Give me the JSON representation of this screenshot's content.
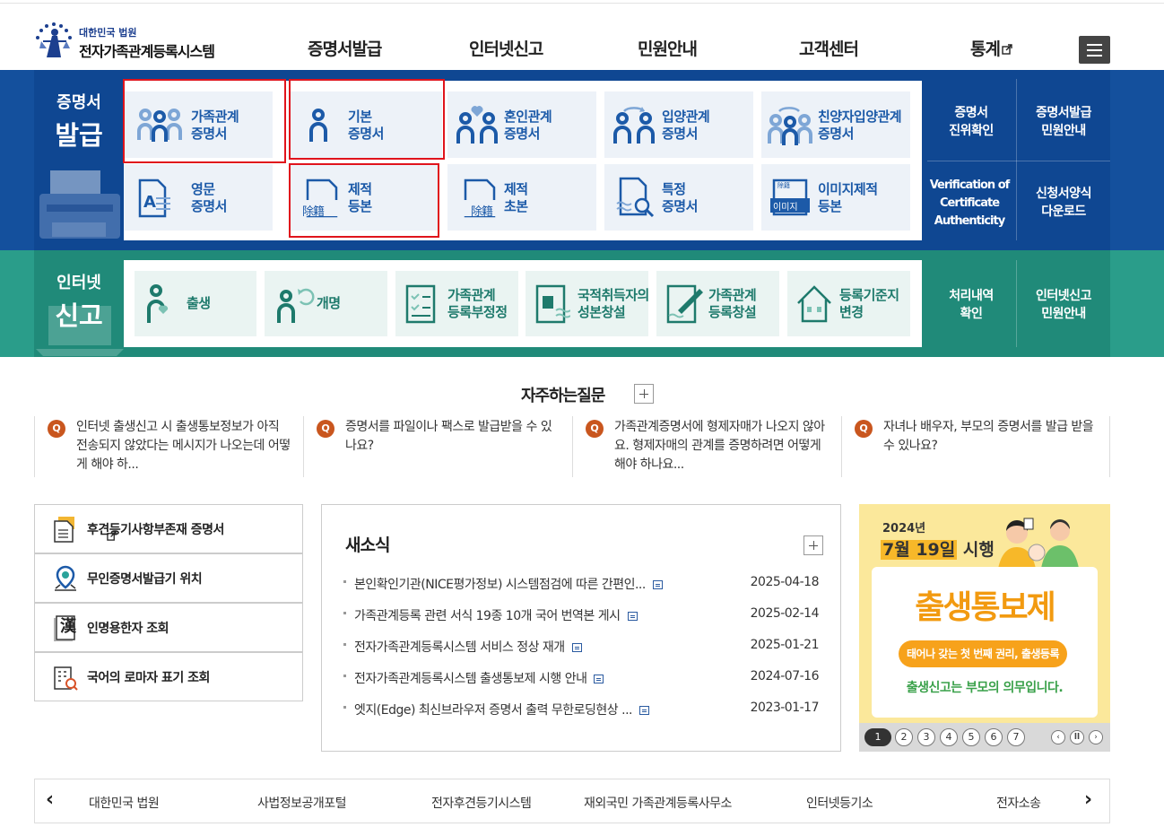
{
  "header": {
    "logo_small": "대한민국 법원",
    "logo_big": "전자가족관계등록시스템",
    "nav": [
      "증명서발급",
      "인터넷신고",
      "민원안내",
      "고객센터",
      "통계"
    ]
  },
  "issue": {
    "title_1": "증명서",
    "title_2": "발급",
    "tiles": [
      {
        "l1": "가족관계",
        "l2": "증명서"
      },
      {
        "l1": "기본",
        "l2": "증명서"
      },
      {
        "l1": "혼인관계",
        "l2": "증명서"
      },
      {
        "l1": "입양관계",
        "l2": "증명서"
      },
      {
        "l1": "친양자입양관계",
        "l2": "증명서"
      },
      {
        "l1": "영문",
        "l2": "증명서"
      },
      {
        "l1": "제적",
        "l2": "등본"
      },
      {
        "l1": "제적",
        "l2": "초본"
      },
      {
        "l1": "특정",
        "l2": "증명서"
      },
      {
        "l1": "이미지제적",
        "l2": "등본"
      }
    ],
    "icon_text": {
      "jejeok": "除籍",
      "image": "이미지",
      "image_top": "除籍"
    },
    "side": [
      {
        "l1": "증명서",
        "l2": "진위확인"
      },
      {
        "l1": "증명서발급",
        "l2": "민원안내"
      },
      {
        "l1": "Verification of",
        "l2": "Certificate",
        "l3": "Authenticity"
      },
      {
        "l1": "신청서양식",
        "l2": "다운로드"
      }
    ]
  },
  "report": {
    "title_1": "인터넷",
    "title_2": "신고",
    "tiles": [
      {
        "l1": "출생",
        "l2": ""
      },
      {
        "l1": "개명",
        "l2": ""
      },
      {
        "l1": "가족관계",
        "l2": "등록부정정"
      },
      {
        "l1": "국적취득자의",
        "l2": "성본창설"
      },
      {
        "l1": "가족관계",
        "l2": "등록창설"
      },
      {
        "l1": "등록기준지",
        "l2": "변경"
      }
    ],
    "side": [
      {
        "l1": "처리내역",
        "l2": "확인"
      },
      {
        "l1": "인터넷신고",
        "l2": "민원안내"
      }
    ]
  },
  "faq": {
    "title": "자주하는질문",
    "q_mark": "Q",
    "items": [
      "인터넷 출생신고 시 출생통보정보가 아직 전송되지 않았다는 메시지가 나오는데 어떻게 해야 하...",
      "증명서를 파일이나 팩스로 발급받을 수 있나요?",
      "가족관계증명서에 형제자매가 나오지 않아요. 형제자매의 관계를 증명하려면 어떻게 해야 하나요...",
      "자녀나 배우자, 부모의 증명서를 발급 받을 수 있나요?"
    ]
  },
  "quick": {
    "items": [
      "후견등기사항부존재 증명서",
      "무인증명서발급기 위치",
      "인명용한자 조회",
      "국어의 로마자 표기 조회"
    ],
    "hanja": "漢"
  },
  "news": {
    "title": "새소식",
    "items": [
      {
        "text": "본인확인기관(NICE평가정보) 시스템점검에 따른 간편인...",
        "date": "2025-04-18"
      },
      {
        "text": "가족관계등록 관련 서식 19종 10개 국어 번역본 게시",
        "date": "2025-02-14"
      },
      {
        "text": "전자가족관계등록시스템 서비스 정상 재개",
        "date": "2025-01-21"
      },
      {
        "text": "전자가족관계등록시스템 출생통보제 시행 안내",
        "date": "2024-07-16"
      },
      {
        "text": "엣지(Edge) 최신브라우저 증명서 출력 무한로딩현상 ...",
        "date": "2023-01-17"
      }
    ]
  },
  "banner": {
    "year": "2024년",
    "date_pre": "7월 19일",
    "date_post": " 시행",
    "main": "출생통보제",
    "pill": "태어나 갖는 첫 번째 권리, 출생등록",
    "sub": "출생신고는 부모의 의무입니다.",
    "pages": [
      "1",
      "2",
      "3",
      "4",
      "5",
      "6",
      "7"
    ],
    "prev": "‹",
    "pause": "ll",
    "next": "›"
  },
  "footer": {
    "prev": "‹",
    "next": "›",
    "links": [
      "대한민국 법원",
      "사법정보공개포털",
      "전자후견등기시스템",
      "재외국민 가족관계등록사무소",
      "인터넷등기소",
      "전자소송"
    ]
  }
}
